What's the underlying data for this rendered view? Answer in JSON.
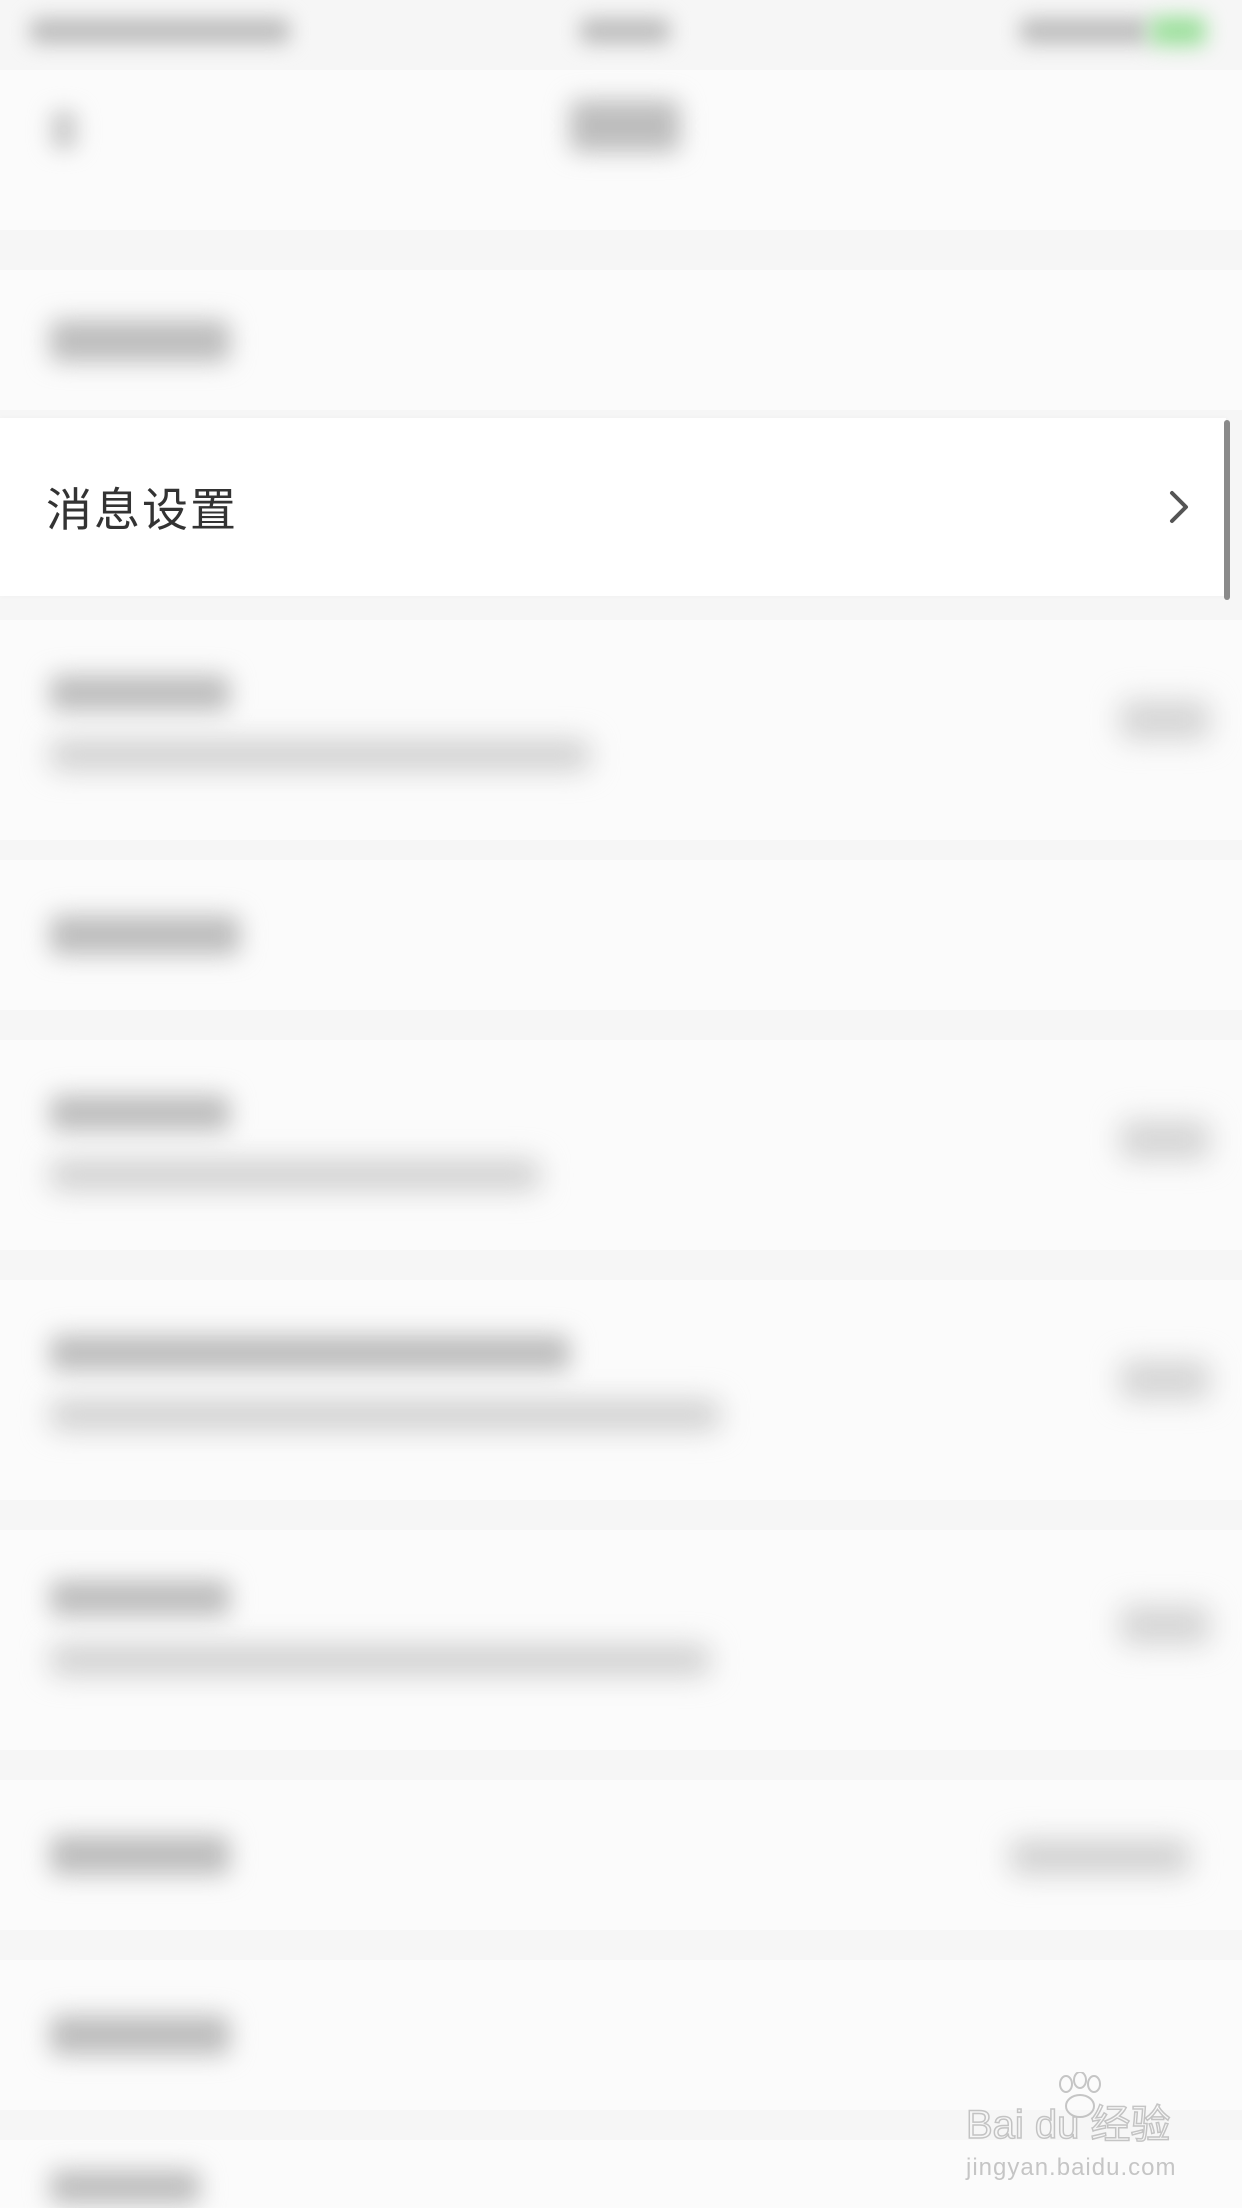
{
  "settings_row": {
    "label": "消息设置",
    "chevron_icon": "chevron-right-icon"
  },
  "watermark": {
    "brand": "Bai du 经验",
    "url": "jingyan.baidu.com"
  },
  "colors": {
    "background": "#f6f6f6",
    "row_bg": "#ffffff",
    "text": "#333333",
    "chevron": "#555555",
    "battery_green": "#7ccf7c"
  }
}
